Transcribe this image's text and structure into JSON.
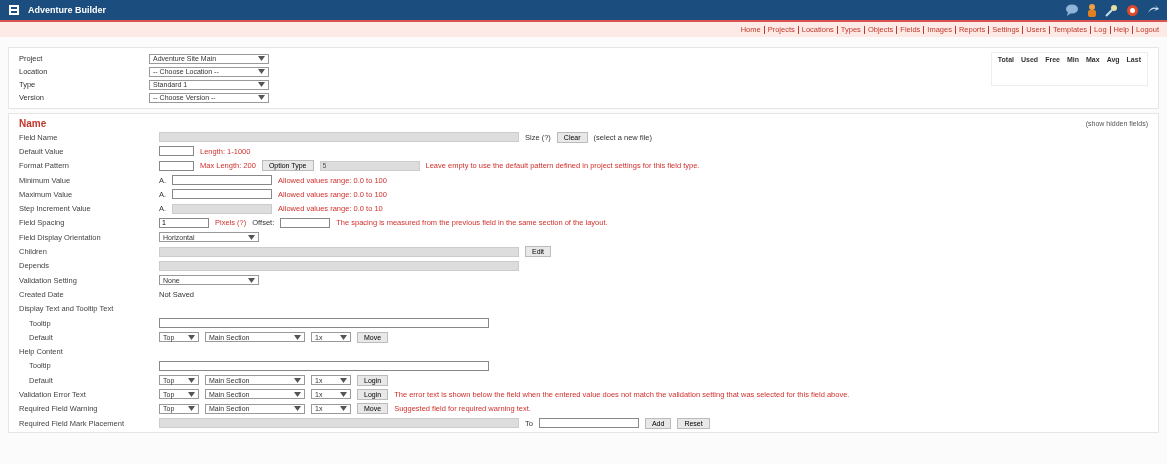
{
  "header": {
    "title": "Adventure Builder"
  },
  "nav_links": [
    "Home",
    "Projects",
    "Locations",
    "Types",
    "Objects",
    "Fields",
    "Images",
    "Reports",
    "Settings",
    "Users",
    "Templates",
    "Log",
    "Help",
    "Logout"
  ],
  "filters": [
    {
      "label": "Project",
      "value": "Adventure Site Main"
    },
    {
      "label": "Location",
      "value": "-- Choose Location --"
    },
    {
      "label": "Type",
      "value": "Standard 1"
    },
    {
      "label": "Version",
      "value": "-- Choose Version --"
    }
  ],
  "summary": {
    "columns": [
      "Total",
      "Used",
      "Free",
      "Min",
      "Max",
      "Avg",
      "Last"
    ]
  },
  "section": {
    "title": "Name",
    "toggle_link": "(show hidden fields)"
  },
  "fields": [
    {
      "label": "Field Name",
      "controls": [
        {
          "kind": "wide_input",
          "disabled": true
        },
        {
          "kind": "text",
          "value": "Size (?)"
        },
        {
          "kind": "button",
          "value": "Clear"
        },
        {
          "kind": "text",
          "value": "(select a new file)"
        }
      ]
    },
    {
      "label": "Default Value",
      "controls": [
        {
          "kind": "short_input",
          "disabled": false
        },
        {
          "kind": "note",
          "value": "Length: 1-1000"
        }
      ]
    },
    {
      "label": "Format Pattern",
      "controls": [
        {
          "kind": "short_input",
          "disabled": false
        },
        {
          "kind": "note",
          "value": "Max Length: 200"
        },
        {
          "kind": "button",
          "value": "Option Type"
        },
        {
          "kind": "input",
          "value": "5",
          "disabled": true
        },
        {
          "kind": "note",
          "value": "Leave empty to use the default pattern defined in project settings for this field type."
        }
      ]
    },
    {
      "label": "Minimum Value",
      "controls": [
        {
          "kind": "text",
          "value": "A."
        },
        {
          "kind": "input",
          "disabled": false
        },
        {
          "kind": "note",
          "value": "Allowed values range: 0.0 to 100"
        }
      ]
    },
    {
      "label": "Maximum Value",
      "controls": [
        {
          "kind": "text",
          "value": "A."
        },
        {
          "kind": "input",
          "disabled": false
        },
        {
          "kind": "note",
          "value": "Allowed values range: 0.0 to 100"
        }
      ]
    },
    {
      "label": "Step Increment Value",
      "controls": [
        {
          "kind": "text",
          "value": "A."
        },
        {
          "kind": "input",
          "disabled": true
        },
        {
          "kind": "note",
          "value": "Allowed values range: 0.0 to 10"
        }
      ]
    },
    {
      "label": "Field Spacing",
      "controls": [
        {
          "kind": "tiny_input",
          "value": "1",
          "disabled": false
        },
        {
          "kind": "note",
          "value": "Pixels (?)"
        },
        {
          "kind": "text",
          "value": "Offset:"
        },
        {
          "kind": "tiny_input",
          "disabled": false
        },
        {
          "kind": "note",
          "value": "The spacing is measured from the previous field in the same section of the layout."
        }
      ]
    },
    {
      "label": "Field Display Orientation",
      "controls": [
        {
          "kind": "select",
          "value": "Horizontal"
        }
      ]
    },
    {
      "label": "Children",
      "controls": [
        {
          "kind": "wide_input",
          "disabled": true
        },
        {
          "kind": "button",
          "value": "Edit"
        }
      ]
    },
    {
      "label": "Depends",
      "controls": [
        {
          "kind": "wide_input",
          "disabled": true
        }
      ]
    },
    {
      "label": "Validation Setting",
      "controls": [
        {
          "kind": "select",
          "value": "None"
        }
      ]
    },
    {
      "label": "Created Date",
      "controls": [
        {
          "kind": "text",
          "value": "Not Saved"
        }
      ]
    },
    {
      "label": "Display Text and Tooltip Text",
      "children": [
        {
          "label": "Tooltip",
          "controls": [
            {
              "kind": "long_input",
              "disabled": false
            }
          ]
        },
        {
          "label": "Default",
          "controls": [
            {
              "kind": "select_small",
              "value": "Top"
            },
            {
              "kind": "select",
              "value": "Main Section"
            },
            {
              "kind": "select_small",
              "value": "1x"
            },
            {
              "kind": "button",
              "value": "Move"
            }
          ]
        }
      ]
    },
    {
      "label": "Help Content",
      "children": [
        {
          "label": "Tooltip",
          "controls": [
            {
              "kind": "long_input",
              "disabled": false
            }
          ]
        },
        {
          "label": "Default",
          "controls": [
            {
              "kind": "select_small",
              "value": "Top"
            },
            {
              "kind": "select",
              "value": "Main Section"
            },
            {
              "kind": "select_small",
              "value": "1x"
            },
            {
              "kind": "button",
              "value": "Login"
            }
          ]
        }
      ]
    },
    {
      "label": "Validation Error Text",
      "controls": [
        {
          "kind": "select_small",
          "value": "Top"
        },
        {
          "kind": "select",
          "value": "Main Section"
        },
        {
          "kind": "select_small",
          "value": "1x"
        },
        {
          "kind": "button",
          "value": "Login"
        },
        {
          "kind": "note",
          "value": "The error text is shown below the field when the entered value does not match the validation setting that was selected for this field above."
        }
      ]
    },
    {
      "label": "Required Field Warning",
      "controls": [
        {
          "kind": "select_small",
          "value": "Top"
        },
        {
          "kind": "select",
          "value": "Main Section"
        },
        {
          "kind": "select_small",
          "value": "1x"
        },
        {
          "kind": "button",
          "value": "Move"
        },
        {
          "kind": "note",
          "value": "Suggested field for required warning text."
        }
      ]
    },
    {
      "label": "Required Field Mark Placement",
      "controls": [
        {
          "kind": "wide_input",
          "disabled": true
        },
        {
          "kind": "text",
          "value": "To"
        },
        {
          "kind": "input",
          "disabled": false
        },
        {
          "kind": "button",
          "value": "Add"
        },
        {
          "kind": "button",
          "value": "Reset"
        }
      ]
    }
  ]
}
